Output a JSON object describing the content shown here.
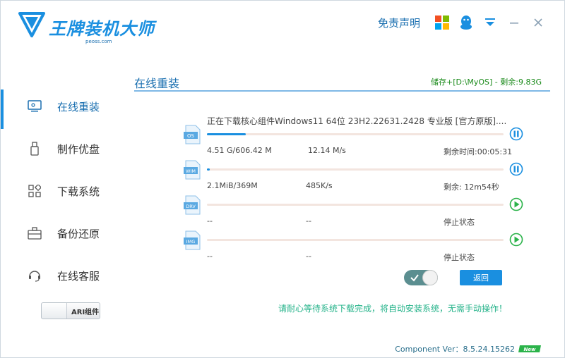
{
  "app": {
    "title": "王牌装机大师",
    "subtitle": "peoss.com"
  },
  "header": {
    "disclaimer": "免责声明"
  },
  "sidebar": {
    "items": [
      {
        "label": "在线重装",
        "icon": "monitor-icon",
        "active": true
      },
      {
        "label": "制作优盘",
        "icon": "usb-icon",
        "active": false
      },
      {
        "label": "下载系统",
        "icon": "grid-icon",
        "active": false
      },
      {
        "label": "备份还原",
        "icon": "briefcase-icon",
        "active": false
      },
      {
        "label": "在线客服",
        "icon": "headset-icon",
        "active": false
      }
    ],
    "ari_label": "ARI组件"
  },
  "main": {
    "title": "在线重装",
    "storage": "储存+[D:\\MyOS] - 剩余:9.83G",
    "status": "正在下载核心组件Windows11 64位 23H2.22631.2428 专业版 [官方原版]....",
    "downloads": [
      {
        "icon_label": "OS",
        "progress": 0.13,
        "size": "4.51 G/606.42 M",
        "speed": "12.14 M/s",
        "remaining": "剩余时间:00:05:31",
        "state": "paused-control"
      },
      {
        "icon_label": "WIM",
        "progress": 0.01,
        "size": "2.1MiB/369M",
        "speed": "485K/s",
        "remaining": "剩余: 12m54秒",
        "state": "paused-control"
      },
      {
        "icon_label": "DRV",
        "progress": 0.0,
        "size": "--",
        "speed": "--",
        "remaining": "停止状态",
        "state": "play-control"
      },
      {
        "icon_label": "IMG",
        "progress": 0.0,
        "size": "--",
        "speed": "--",
        "remaining": "停止状态",
        "state": "play-control"
      }
    ],
    "back_label": "返回",
    "hint": "请耐心等待系统下载完成，将自动安装系统，无需手动操作！"
  },
  "footer": {
    "version": "Component Ver：8.5.24.15262",
    "badge": "New"
  },
  "colors": {
    "accent": "#1a8fe0",
    "storage": "#1a8a1a",
    "hint": "#25b38a",
    "play": "#2bb34a"
  }
}
